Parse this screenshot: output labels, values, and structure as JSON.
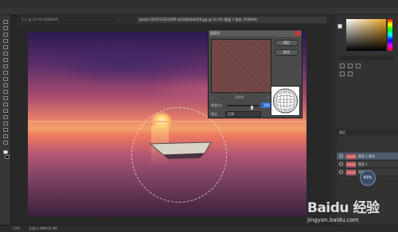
{
  "tabs": [
    {
      "label": "5_1 @ 33.3% (RGB/8#)",
      "active": false
    },
    {
      "label": "photo-1500534314209-a25ddb2bd429.jpg @ 33.3% (图层 1 副本, RGB/8#)",
      "active": true
    }
  ],
  "dialog": {
    "title": "球面化",
    "ok_label": "确定",
    "cancel_label": "取消",
    "zoom_value": "100%",
    "amount_label": "数量(A)",
    "amount_value": "100",
    "mode_label": "模式",
    "mode_value": "正常"
  },
  "layers": {
    "tabs_label": "图层",
    "items": [
      {
        "name": "图层 1 副本",
        "selected": true
      },
      {
        "name": "图层 1",
        "selected": false
      },
      {
        "name": "背景",
        "selected": false
      }
    ]
  },
  "status": {
    "zoom": "33%",
    "doc": "文档:5.49M/10.9M"
  },
  "badge": "43%",
  "watermark": {
    "logo": "Baidu 经验",
    "url": "jingyan.baidu.com"
  },
  "colors": {
    "accent": "#2f6bd1",
    "panel_bg": "#323232",
    "selected_layer": "#4d5b6c"
  }
}
